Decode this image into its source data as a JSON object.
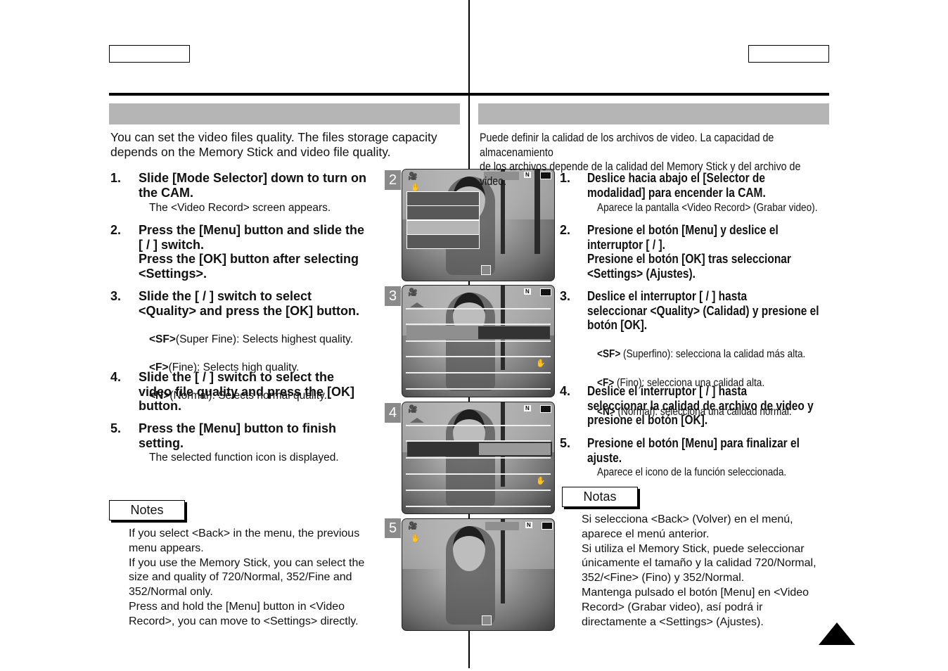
{
  "english": {
    "intro": "You can set the video files quality. The files storage capacity\ndepends on the Memory Stick and video file quality.",
    "steps": [
      {
        "num": "1.",
        "text": "Slide [Mode Selector] down to turn on\nthe CAM.",
        "sub": "The <Video Record> screen appears."
      },
      {
        "num": "2.",
        "text": "Press the [Menu] button and slide the\n[     /     ] switch.\nPress the [OK] button after selecting\n<Settings>."
      },
      {
        "num": "3.",
        "text": "Slide the [     /     ] switch to select\n<Quality> and press the [OK] button.",
        "opts": [
          {
            "k": "<SF>",
            "v": "(Super Fine): Selects highest quality."
          },
          {
            "k": "<F>",
            "v": "(Fine): Selects high quality."
          },
          {
            "k": "<N>",
            "v": "(Normal): Selects normal quality."
          }
        ]
      },
      {
        "num": "4.",
        "text": "Slide the [     /     ] switch to select the\nvideo file quality and press the [OK]\nbutton."
      },
      {
        "num": "5.",
        "text": "Press the [Menu] button to finish\nsetting.",
        "sub": "The selected function icon is displayed."
      }
    ],
    "notes_title": "Notes",
    "notes": "If you select <Back> in the menu, the previous\nmenu appears.\nIf you use the Memory Stick, you can select the\nsize and quality of 720/Normal, 352/Fine and\n352/Normal only.\nPress and hold the [Menu] button in <Video\nRecord>, you can move to <Settings> directly."
  },
  "spanish": {
    "intro": "Puede definir la calidad de los archivos de video. La capacidad de almacenamiento\nde los archivos depende de la calidad del Memory Stick y del archivo de video.",
    "steps": [
      {
        "num": "1.",
        "text": "Deslice hacia abajo el [Selector de\nmodalidad] para encender la CAM.",
        "sub": "Aparece la pantalla <Video Record> (Grabar video)."
      },
      {
        "num": "2.",
        "text": "Presione el botón [Menu] y deslice el\ninterruptor [     /     ].\nPresione el botón [OK] tras seleccionar\n<Settings> (Ajustes)."
      },
      {
        "num": "3.",
        "text": "Deslice el interruptor [     /     ] hasta\nseleccionar <Quality> (Calidad) y presione el\nbotón [OK].",
        "opts": [
          {
            "k": "<SF>",
            "v": " (Superfino): selecciona la calidad más alta."
          },
          {
            "k": "<F>",
            "v": " (Fino): selecciona una calidad alta."
          },
          {
            "k": "<N>",
            "v": " (Normal): selecciona una calidad normal."
          }
        ]
      },
      {
        "num": "4.",
        "text": "Deslice el interruptor [     /     ] hasta\nseleccionar la calidad de archivo de video y\npresione el botón [OK]."
      },
      {
        "num": "5.",
        "text": "Presione el botón [Menu] para finalizar el\najuste.",
        "sub": "Aparece el icono de la función seleccionada."
      }
    ],
    "notes_title": "Notas",
    "notes": "Si selecciona <Back> (Volver) en el menú,\naparece el menú anterior.\nSi utiliza el Memory Stick, puede seleccionar\núnicamente el tamaño y la calidad 720/Normal,\n352/<Fine> (Fino) y 352/Normal.\nMantenga pulsado el botón [Menu] en <Video\nRecord> (Grabar video), así podrá ir\ndirectamente a <Settings> (Ajustes)."
  },
  "screens": [
    {
      "label": "2"
    },
    {
      "label": "3"
    },
    {
      "label": "4"
    },
    {
      "label": "5"
    }
  ],
  "icons": {
    "camera": "video-camera-icon",
    "stick": "memory-stick-icon",
    "battery": "battery-icon",
    "hand": "anti-shake-icon",
    "next_page": "triangle-up-icon"
  },
  "colors": {
    "header_bar": "#b5b5b5",
    "label_box": "#8a8a8a"
  }
}
